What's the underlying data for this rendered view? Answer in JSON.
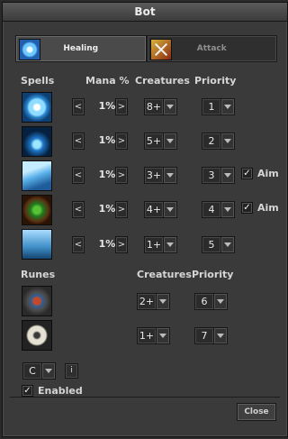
{
  "window": {
    "title": "Bot"
  },
  "tabs": [
    {
      "label": "Healing",
      "icon": "healing-icon",
      "active": true
    },
    {
      "label": "Attack",
      "icon": "attack-icon",
      "active": false
    }
  ],
  "headers": {
    "spells": "Spells",
    "mana": "Mana %",
    "creatures": "Creatures",
    "priority": "Priority",
    "runes": "Runes",
    "creatures2": "Creatures",
    "priority2": "Priority"
  },
  "spells": [
    {
      "icon": "ice-spell-icon",
      "mana": "1%",
      "creatures": "8+",
      "priority": "1",
      "aim": null
    },
    {
      "icon": "frost-spell-icon",
      "mana": "1%",
      "creatures": "5+",
      "priority": "2",
      "aim": null
    },
    {
      "icon": "ice-wave-spell-icon",
      "mana": "1%",
      "creatures": "3+",
      "priority": "3",
      "aim": "Aim"
    },
    {
      "icon": "poison-spell-icon",
      "mana": "1%",
      "creatures": "4+",
      "priority": "4",
      "aim": "Aim"
    },
    {
      "icon": "storm-spell-icon",
      "mana": "1%",
      "creatures": "1+",
      "priority": "5",
      "aim": null
    }
  ],
  "arrows": {
    "left": "<",
    "right": ">"
  },
  "runes": [
    {
      "icon": "rune-icon",
      "creatures": "2+",
      "priority": "6"
    },
    {
      "icon": "stone-rune-icon",
      "creatures": "1+",
      "priority": "7"
    }
  ],
  "footer": {
    "hotkey": "C",
    "info": "i",
    "enabled_label": "Enabled",
    "enabled": true,
    "close": "Close"
  },
  "check_glyph": "✓"
}
